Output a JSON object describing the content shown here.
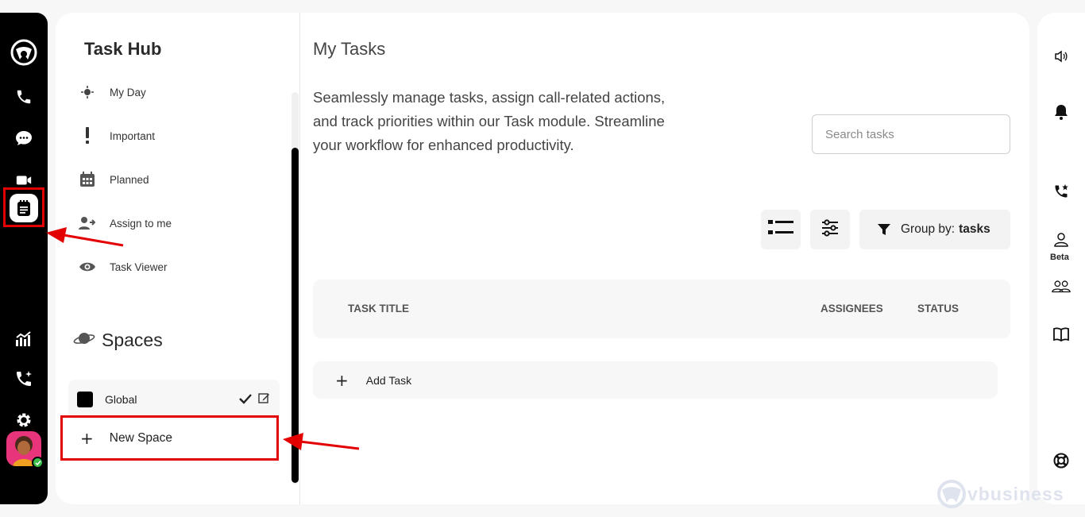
{
  "left_rail": {
    "items": [
      {
        "name": "logo-icon"
      },
      {
        "name": "phone-icon"
      },
      {
        "name": "chat-icon"
      },
      {
        "name": "video-icon"
      },
      {
        "name": "tasks-icon",
        "active": true
      },
      {
        "name": "analytics-icon"
      },
      {
        "name": "phone-sparkle-icon"
      },
      {
        "name": "settings-icon"
      }
    ],
    "accent_highlight": "#e30000"
  },
  "hub": {
    "title": "Task Hub",
    "items": [
      {
        "label": "My Day",
        "icon": "sun-icon"
      },
      {
        "label": "Important",
        "icon": "exclamation-icon"
      },
      {
        "label": "Planned",
        "icon": "calendar-icon"
      },
      {
        "label": "Assign to me",
        "icon": "user-assign-icon"
      },
      {
        "label": "Task Viewer",
        "icon": "eye-icon"
      }
    ],
    "spaces_title": "Spaces",
    "spaces": [
      {
        "label": "Global",
        "color": "#000000"
      }
    ],
    "new_space_label": "New Space"
  },
  "main": {
    "title": "My Tasks",
    "description": "Seamlessly manage tasks, assign call-related actions, and track priorities within our Task module. Streamline your workflow for enhanced productivity.",
    "search": {
      "placeholder": "Search tasks",
      "value": ""
    },
    "group_by_label": "Group by:",
    "group_by_value": "tasks",
    "table_headers": [
      "TASK TITLE",
      "ASSIGNEES",
      "STATUS"
    ],
    "add_task_label": "Add Task"
  },
  "right_rail": {
    "items": [
      "speaker-icon",
      "bell-icon",
      "phone-star-icon",
      "user-icon",
      "group-icon",
      "book-icon",
      "lifebuoy-icon"
    ],
    "beta_label": "Beta"
  },
  "watermark": "vbusiness"
}
